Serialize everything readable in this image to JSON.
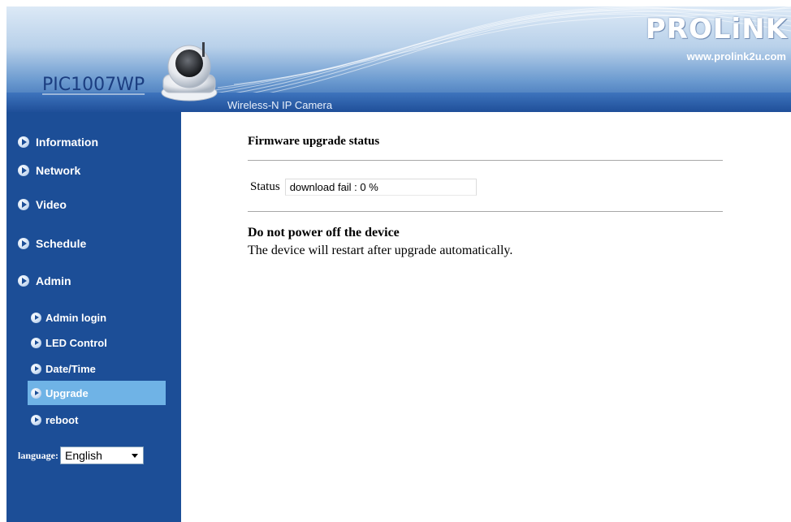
{
  "header": {
    "model_name": "PIC1007WP",
    "product_subtitle": "Wireless-N IP Camera",
    "brand_logo": "PROLiNK",
    "brand_url": "www.prolink2u.com"
  },
  "sidebar": {
    "main_items": [
      {
        "label": "Information"
      },
      {
        "label": "Network"
      },
      {
        "label": "Video"
      },
      {
        "label": "Schedule"
      },
      {
        "label": "Admin"
      }
    ],
    "admin_items": [
      {
        "label": "Admin login"
      },
      {
        "label": "LED Control"
      },
      {
        "label": "Date/Time"
      },
      {
        "label": "Upgrade",
        "active": true
      },
      {
        "label": "reboot"
      }
    ],
    "language_label": "language:",
    "language_value": "English"
  },
  "main": {
    "section_title": "Firmware upgrade status",
    "status_label": "Status",
    "status_value": "download fail : 0 %",
    "warning_title": "Do not power off the device",
    "warning_text": "The device will restart after upgrade automatically."
  },
  "colors": {
    "sidebar_bg": "#1c4e97",
    "active_item_bg": "#6fb3e6",
    "banner_bar": "#2a5ca8"
  }
}
